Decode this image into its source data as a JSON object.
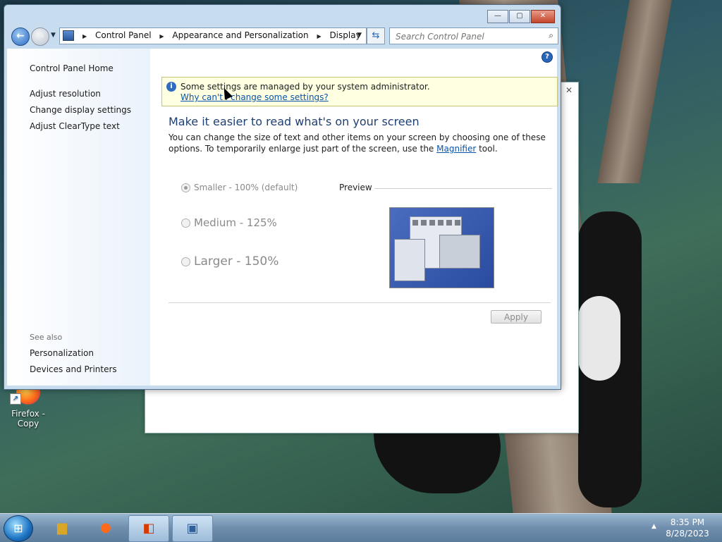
{
  "desktop": {
    "icon_label": "Firefox - Copy"
  },
  "window": {
    "buttons": {
      "minimize": "—",
      "maximize": "▢",
      "close": "✕"
    },
    "address": {
      "crumbs": [
        "Control Panel",
        "Appearance and Personalization",
        "Display"
      ]
    },
    "search": {
      "placeholder": "Search Control Panel"
    },
    "help_icon": "?",
    "sidebar": {
      "home": "Control Panel Home",
      "links": [
        "Adjust resolution",
        "Change display settings",
        "Adjust ClearType text"
      ],
      "see_also": "See also",
      "see_also_links": [
        "Personalization",
        "Devices and Printers"
      ]
    },
    "main": {
      "info_text": "Some settings are managed by your system administrator.",
      "info_link": "Why can't I change some settings?",
      "heading": "Make it easier to read what's on your screen",
      "desc_before": "You can change the size of text and other items on your screen by choosing one of these options. To temporarily enlarge just part of the screen, use the ",
      "desc_link": "Magnifier",
      "desc_after": " tool.",
      "options": [
        "Smaller - 100% (default)",
        "Medium - 125%",
        "Larger - 150%"
      ],
      "selected_option": "Smaller - 100% (default)",
      "preview_label": "Preview",
      "apply": "Apply"
    }
  },
  "taskbar": {
    "time": "8:35 PM",
    "date": "8/28/2023"
  },
  "colors": {
    "link": "#0a53a8",
    "heading": "#1e3f74",
    "info_bg": "#ffffe1",
    "window_frame": "#c8dcef"
  }
}
